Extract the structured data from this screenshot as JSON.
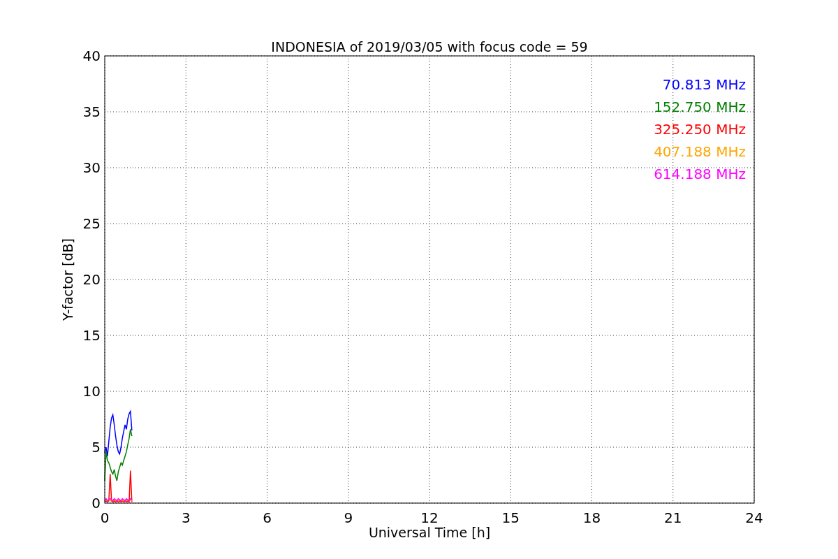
{
  "chart_data": {
    "type": "line",
    "title": "INDONESIA of 2019/03/05 with focus code = 59",
    "xlabel": "Universal Time [h]",
    "ylabel": "Y-factor [dB]",
    "x": [
      0,
      0.05,
      0.1,
      0.15,
      0.2,
      0.25,
      0.3,
      0.35,
      0.4,
      0.45,
      0.5,
      0.55,
      0.6,
      0.65,
      0.7,
      0.75,
      0.8,
      0.85,
      0.9,
      0.95,
      1.0
    ],
    "series": [
      {
        "name": "70.813 MHz",
        "color": "#0000ff",
        "values": [
          4.5,
          5.0,
          4.2,
          5.5,
          6.8,
          7.6,
          7.9,
          7.0,
          6.0,
          5.2,
          4.6,
          4.4,
          5.0,
          5.8,
          6.4,
          7.0,
          6.6,
          7.5,
          8.0,
          8.2,
          6.5
        ]
      },
      {
        "name": "152.750 MHz",
        "color": "#008000",
        "values": [
          2.0,
          4.6,
          3.8,
          3.6,
          3.2,
          2.8,
          2.6,
          3.0,
          2.4,
          2.0,
          2.8,
          3.2,
          3.6,
          3.4,
          3.8,
          4.2,
          4.6,
          5.2,
          5.8,
          6.6,
          6.0
        ]
      },
      {
        "name": "325.250 MHz",
        "color": "#ff0000",
        "values": [
          0.1,
          0.2,
          0.1,
          0.2,
          2.6,
          0.2,
          0.1,
          0.2,
          0.1,
          0.2,
          0.1,
          0.2,
          0.1,
          0.2,
          0.1,
          0.2,
          0.1,
          0.2,
          0.1,
          2.9,
          0.1
        ]
      },
      {
        "name": "407.188 MHz",
        "color": "#ffa500",
        "values": [
          0.2,
          0.3,
          0.2,
          0.3,
          0.2,
          0.3,
          0.2,
          0.3,
          0.2,
          0.3,
          0.2,
          0.3,
          0.2,
          0.3,
          0.2,
          0.3,
          0.2,
          0.3,
          0.2,
          0.3,
          0.2
        ]
      },
      {
        "name": "614.188 MHz",
        "color": "#ff00ff",
        "values": [
          0.3,
          0.4,
          0.2,
          0.3,
          0.4,
          0.3,
          0.2,
          0.4,
          0.3,
          0.2,
          0.4,
          0.3,
          0.2,
          0.4,
          0.3,
          0.2,
          0.4,
          0.3,
          0.2,
          0.4,
          0.3
        ]
      }
    ],
    "grid": true,
    "xlim": [
      0,
      24
    ],
    "ylim": [
      0,
      40
    ],
    "xticks": [
      0,
      3,
      6,
      9,
      12,
      15,
      18,
      21,
      24
    ],
    "yticks": [
      0,
      5,
      10,
      15,
      20,
      25,
      30,
      35,
      40
    ]
  }
}
